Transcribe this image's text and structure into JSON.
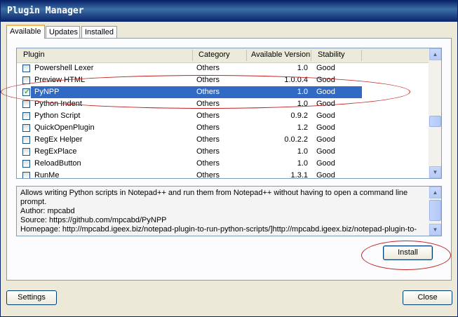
{
  "window": {
    "title": "Plugin Manager"
  },
  "tabs": [
    {
      "label": "Available",
      "active": true
    },
    {
      "label": "Updates",
      "active": false
    },
    {
      "label": "Installed",
      "active": false
    }
  ],
  "list": {
    "columns": [
      "Plugin",
      "Category",
      "Available Version",
      "Stability"
    ],
    "rows": [
      {
        "name": "Powershell Lexer",
        "category": "Others",
        "version": "1.0",
        "stability": "Good",
        "checked": false
      },
      {
        "name": "Preview HTML",
        "category": "Others",
        "version": "1.0.0.4",
        "stability": "Good",
        "checked": false
      },
      {
        "name": "PyNPP",
        "category": "Others",
        "version": "1.0",
        "stability": "Good",
        "checked": true,
        "selected": true
      },
      {
        "name": "Python Indent",
        "category": "Others",
        "version": "1.0",
        "stability": "Good",
        "checked": false
      },
      {
        "name": "Python Script",
        "category": "Others",
        "version": "0.9.2",
        "stability": "Good",
        "checked": false
      },
      {
        "name": "QuickOpenPlugin",
        "category": "Others",
        "version": "1.2",
        "stability": "Good",
        "checked": false
      },
      {
        "name": "RegEx Helper",
        "category": "Others",
        "version": "0.0.2.2",
        "stability": "Good",
        "checked": false
      },
      {
        "name": "RegExPlace",
        "category": "Others",
        "version": "1.0",
        "stability": "Good",
        "checked": false
      },
      {
        "name": "ReloadButton",
        "category": "Others",
        "version": "1.0",
        "stability": "Good",
        "checked": false
      },
      {
        "name": "RunMe",
        "category": "Others",
        "version": "1.3.1",
        "stability": "Good",
        "checked": false
      }
    ]
  },
  "description": {
    "lines": [
      "Allows writing Python scripts in Notepad++ and run them from Notepad++ without having to open a command line",
      "prompt.",
      "Author: mpcabd",
      "Source: https://github.com/mpcabd/PyNPP",
      "Homepage: http://mpcabd.igeex.biz/notepad-plugin-to-run-python-scripts/]http://mpcabd.igeex.biz/notepad-plugin-to-"
    ]
  },
  "buttons": {
    "install": "Install",
    "settings": "Settings",
    "close": "Close"
  },
  "colors": {
    "selection": "#316ac5",
    "annotation": "#c02020",
    "titlebar": "#0a246a"
  },
  "icons": {
    "scroll_up": "▲",
    "scroll_down": "▼",
    "check": "✓"
  }
}
